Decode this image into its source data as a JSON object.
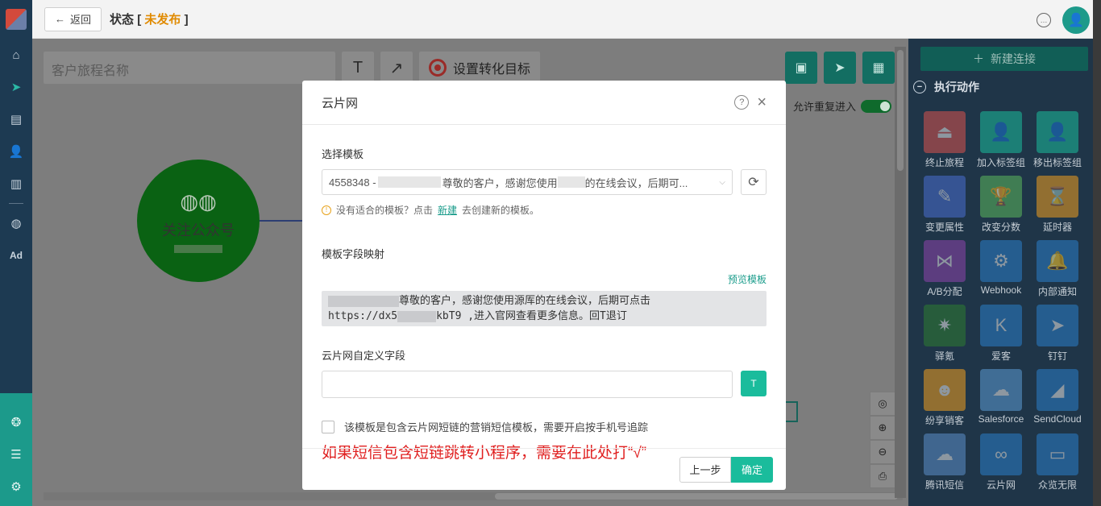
{
  "topbar": {
    "back_label": "返回",
    "status_prefix": "状态",
    "bracket_open": "[",
    "status_value": "未发布",
    "bracket_close": "]"
  },
  "canvas": {
    "journey_name_placeholder": "客户旅程名称",
    "goal_label": "设置转化目标",
    "allow_repeat_label": "允许重复进入",
    "wechat_node_label": "关注公众号"
  },
  "right_panel": {
    "new_connection_label": "新建连接",
    "section_title": "执行动作",
    "actions": [
      {
        "label": "终止旅程",
        "color": "#d9534f",
        "icon": "⏏"
      },
      {
        "label": "加入标签组",
        "color": "#1abc9c",
        "icon": "👤"
      },
      {
        "label": "移出标签组",
        "color": "#1abc9c",
        "icon": "👤"
      },
      {
        "label": "变更属性",
        "color": "#4a6fd1",
        "icon": "✎"
      },
      {
        "label": "改变分数",
        "color": "#5cb85c",
        "icon": "🏆"
      },
      {
        "label": "延时器",
        "color": "#f0a020",
        "icon": "⌛"
      },
      {
        "label": "A/B分配",
        "color": "#8e44ad",
        "icon": "⋈"
      },
      {
        "label": "Webhook",
        "color": "#2a7fc9",
        "icon": "⚙"
      },
      {
        "label": "内部通知",
        "color": "#2a7fc9",
        "icon": "🔔"
      },
      {
        "label": "驿氪",
        "color": "#2e7d32",
        "icon": "✷"
      },
      {
        "label": "爱客",
        "color": "#2a7fc9",
        "icon": "K"
      },
      {
        "label": "钉钉",
        "color": "#2a7fc9",
        "icon": "➤"
      },
      {
        "label": "纷享销客",
        "color": "#f0a020",
        "icon": "☻"
      },
      {
        "label": "Salesforce",
        "color": "#5b9bd5",
        "icon": "☁"
      },
      {
        "label": "SendCloud",
        "color": "#2a7fc9",
        "icon": "◢"
      },
      {
        "label": "腾讯短信",
        "color": "#5b8fc9",
        "icon": "☁"
      },
      {
        "label": "云片网",
        "color": "#2a7fc9",
        "icon": "∞"
      },
      {
        "label": "众览无限",
        "color": "#2a7fc9",
        "icon": "▭"
      }
    ]
  },
  "modal": {
    "title": "云片网",
    "template_label": "选择模板",
    "template_selected_prefix": "4558348 -",
    "template_selected_mid": "尊敬的客户，感谢您使用",
    "template_selected_suffix": "的在线会议，后期可...",
    "hint_before": "没有适合的模板？点击",
    "hint_link": "新建",
    "hint_after": "去创建新的模板。",
    "mapping_label": "模板字段映射",
    "preview_link": "预览模板",
    "preview_line1": "尊敬的客户，感谢您使用源厍的在线会议，后期可点击",
    "preview_line2_a": "https://dx5",
    "preview_line2_b": "kbT9 ,进入官网查看更多信息。回T退订",
    "custom_field_label": "云片网自定义字段",
    "checkbox_label": "该模板是包含云片网短链的营销短信模板，需要开启按手机号追踪",
    "annotation": "如果短信包含短链跳转小程序，需要在此处打“√”",
    "prev_button": "上一步",
    "ok_button": "确定"
  }
}
